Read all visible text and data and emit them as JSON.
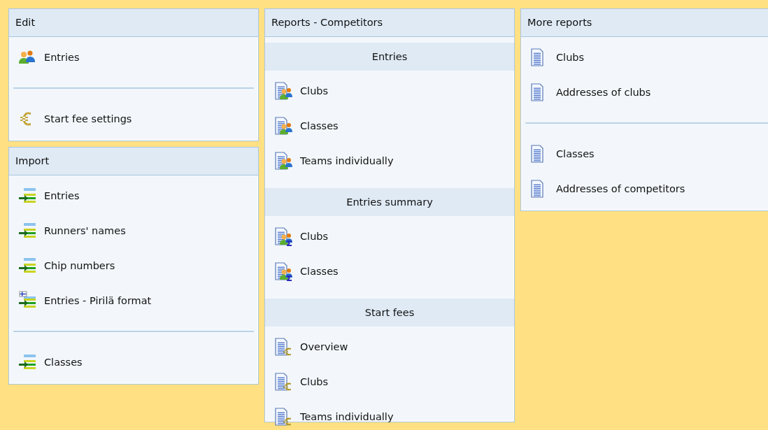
{
  "columns": [
    {
      "panels": [
        {
          "title": "Edit",
          "sections": [
            {
              "groups": [
                [
                  {
                    "kind": "people",
                    "label": "Entries"
                  }
                ],
                [
                  {
                    "kind": "euro",
                    "label": "Start fee settings"
                  }
                ]
              ]
            }
          ]
        },
        {
          "title": "Import",
          "sections": [
            {
              "groups": [
                [
                  {
                    "kind": "import",
                    "label": "Entries"
                  },
                  {
                    "kind": "import",
                    "label": "Runners' names"
                  },
                  {
                    "kind": "import",
                    "label": "Chip numbers"
                  },
                  {
                    "kind": "import-flag",
                    "label": "Entries - Pirilä format"
                  }
                ],
                [
                  {
                    "kind": "import",
                    "label": "Classes"
                  }
                ]
              ]
            }
          ]
        }
      ]
    },
    {
      "panels": [
        {
          "title": "Reports - Competitors",
          "sections": [
            {
              "heading": "Entries",
              "groups": [
                [
                  {
                    "kind": "report-people",
                    "label": "Clubs"
                  },
                  {
                    "kind": "report-people",
                    "label": "Classes"
                  },
                  {
                    "kind": "report-people",
                    "label": "Teams individually"
                  }
                ]
              ]
            },
            {
              "heading": "Entries summary",
              "groups": [
                [
                  {
                    "kind": "report-sum",
                    "label": "Clubs"
                  },
                  {
                    "kind": "report-sum",
                    "label": "Classes"
                  }
                ]
              ]
            },
            {
              "heading": "Start fees",
              "groups": [
                [
                  {
                    "kind": "report-euro",
                    "label": "Overview"
                  },
                  {
                    "kind": "report-euro",
                    "label": "Clubs"
                  },
                  {
                    "kind": "report-euro",
                    "label": "Teams individually"
                  }
                ]
              ]
            }
          ]
        }
      ]
    },
    {
      "panels": [
        {
          "title": "More reports",
          "sections": [
            {
              "groups": [
                [
                  {
                    "kind": "document",
                    "label": "Clubs"
                  },
                  {
                    "kind": "document",
                    "label": "Addresses of clubs"
                  }
                ],
                [
                  {
                    "kind": "document",
                    "label": "Classes"
                  },
                  {
                    "kind": "document",
                    "label": "Addresses of competitors"
                  }
                ]
              ]
            }
          ]
        }
      ]
    }
  ]
}
